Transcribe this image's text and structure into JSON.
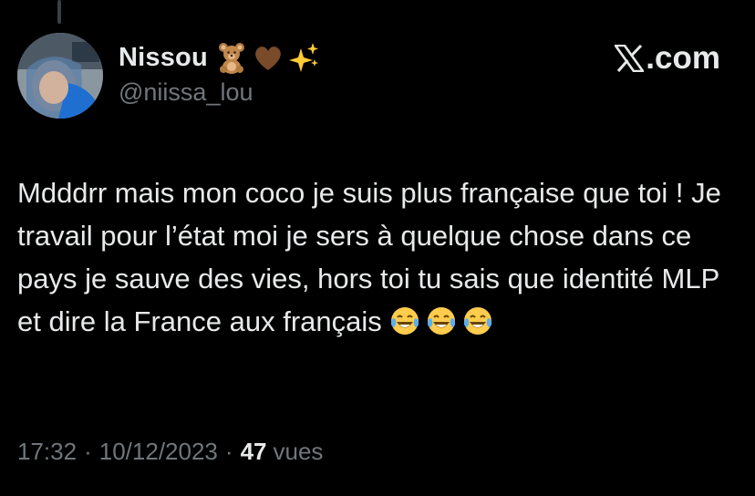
{
  "tweet": {
    "author_name": "Nissou",
    "handle": "@niissa_lou",
    "brand": ".com",
    "text": "Mdddrr mais mon coco je suis plus française que toi ! Je travail pour l’état moi je sers à quelque chose dans ce pays je sauve des vies, hors toi tu sais que identité MLP et dire la France aux français",
    "time": "17:32",
    "separator": "·",
    "date": "10/12/2023",
    "views_count": "47",
    "views_label": "vues"
  },
  "icons": {
    "name_emojis": [
      "teddy-bear-icon",
      "brown-heart-icon",
      "sparkles-icon"
    ],
    "text_emojis": [
      "tears-of-joy-icon",
      "tears-of-joy-icon",
      "tears-of-joy-icon"
    ],
    "brand_logo": "x-logo-icon"
  },
  "colors": {
    "background": "#000000",
    "primary_text": "#e7e9ea",
    "secondary_text": "#71767b"
  }
}
